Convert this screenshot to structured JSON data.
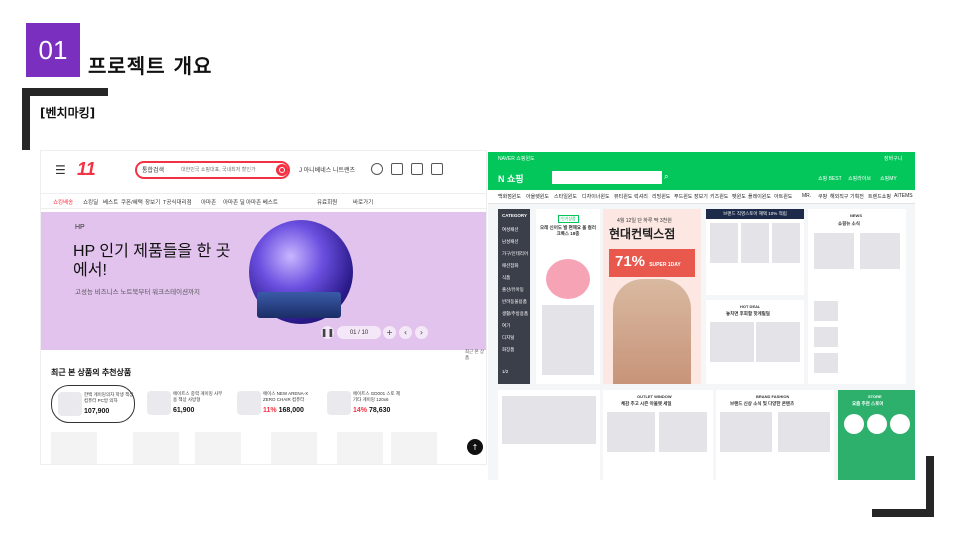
{
  "slide": {
    "number": "01",
    "title": "프로젝트 개요",
    "section_label": "[벤치마킹]"
  },
  "st11": {
    "logo": "11",
    "search": {
      "category": "통합검색",
      "placeholder": "대한민국 쇼핑대표, 국내최저 할인가"
    },
    "promo": "J 아니베네스 니트랜츠",
    "nav": [
      "쇼킹배송",
      "쇼킹딜",
      "베스트",
      "쿠폰/혜택",
      "장보기",
      "T공식대리점",
      "아마존",
      "아마존 딜",
      "아마존 베스트",
      "유료회원",
      "바로가기"
    ],
    "banner": {
      "brand": "HP",
      "title": "HP 인기 제품들을 한 곳에서!",
      "subtitle": "고성능 비즈니스 노트북부터 워크스테이션까지",
      "pager": "01 / 10"
    },
    "recommend_title": "최근 본 상품의 추천상품",
    "cards": [
      {
        "name": "한백 게이밍의자 학생 책상 컴퓨터 PC방 의자",
        "price": "107,900",
        "discount": ""
      },
      {
        "name": "에이트스 중력 게이밍 사무용 책상 사방형",
        "price": "61,900",
        "discount": ""
      },
      {
        "name": "에이스 NEW ARENA-X ZERO CHAIR 컴퓨터",
        "price": "168,000",
        "discount": "11%"
      },
      {
        "name": "에이트스 GD001 스토 제 기타 게이밍 120x6",
        "price": "78,630",
        "discount": "14%"
      }
    ],
    "side_label": "최근 본 상품",
    "top_button": "↑"
  },
  "naver": {
    "top_link": "NAVER 쇼핑윈도",
    "cart_top": "장바구니",
    "logo": "N 쇼핑",
    "header_links": [
      "쇼핑 BEST",
      "쇼핑라이브",
      "쇼핑MY"
    ],
    "categories": [
      "백화점윈도",
      "아울렛윈도",
      "스타일윈도",
      "디자이너윈도",
      "뷰티윈도",
      "럭셔리",
      "리빙윈도",
      "푸드윈도",
      "장보기",
      "키즈윈도",
      "펫윈도",
      "플레이윈도",
      "아트윈도",
      "MR.",
      "쿠팡",
      "해외직구",
      "기획전",
      "트렌드쇼핑",
      "AITEMS"
    ],
    "sidebar": [
      "CATEGORY",
      "여성패션",
      "남성패션",
      "가구/인테리어",
      "패션잡화",
      "식품",
      "출산/유아동",
      "반려동물용품",
      "생활/주방용품",
      "여가",
      "디지털",
      "화장품",
      "1/2"
    ],
    "card1": {
      "badge": "인기상품",
      "title": "오레 신어도 발 편해요 올 컬러 크록스 18종"
    },
    "big": {
      "sub": "4월 12일 단 하루 딱 3천원",
      "title": "현대컨텍스점",
      "percent": "71%",
      "tag": "SUPER 1DAY"
    },
    "card3": {
      "title": "브랜드 직영스토어 혜택 10% 적립"
    },
    "card4": {
      "head": "NEWS",
      "title": "쇼핑뉴 소식"
    },
    "hot_deal": {
      "head": "HOT DEAL",
      "title": "놓치면 후회할 핫게릴딜"
    },
    "outlet": {
      "head": "OUTLET WINDOW",
      "title": "체감 추고 시즌 아울렛 세일"
    },
    "brand": {
      "head": "BRAND FASHION",
      "title": "브랜드 신상 소식 및 다양한 콘텐츠"
    },
    "store": {
      "head": "STORE",
      "title": "요즘 추천 스토어"
    }
  }
}
